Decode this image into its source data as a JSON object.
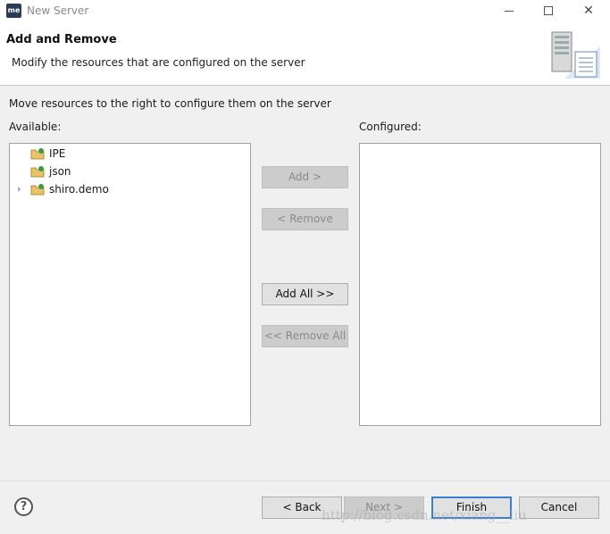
{
  "window": {
    "app_icon_text": "me",
    "title": "New Server",
    "minimize_icon": "minimize-icon",
    "maximize_icon": "maximize-icon",
    "close_glyph": "✕"
  },
  "header": {
    "title": "Add and Remove",
    "description": "Modify the resources that are configured on the server",
    "graphic_icon": "server-wizard-icon"
  },
  "body": {
    "instruction": "Move resources to the right to configure them on the server",
    "available_label": "Available:",
    "configured_label": "Configured:",
    "available_items": [
      {
        "name": "IPE",
        "expandable": false,
        "icon": "project-icon"
      },
      {
        "name": "json",
        "expandable": false,
        "icon": "project-icon"
      },
      {
        "name": "shiro.demo",
        "expandable": true,
        "expand_glyph": "›",
        "icon": "project-icon"
      }
    ],
    "configured_items": []
  },
  "buttons": {
    "add": "Add >",
    "remove": "< Remove",
    "add_all": "Add All >>",
    "remove_all": "<< Remove All",
    "back": "< Back",
    "next": "Next >",
    "finish": "Finish",
    "cancel": "Cancel"
  },
  "help_glyph": "?",
  "watermark": "http://blog.csdn.net/xiang__liu",
  "colors": {
    "finish_border": "#3c7fd1",
    "disabled_button": "#cccccc",
    "dialog_bg": "#f0f0f0"
  }
}
